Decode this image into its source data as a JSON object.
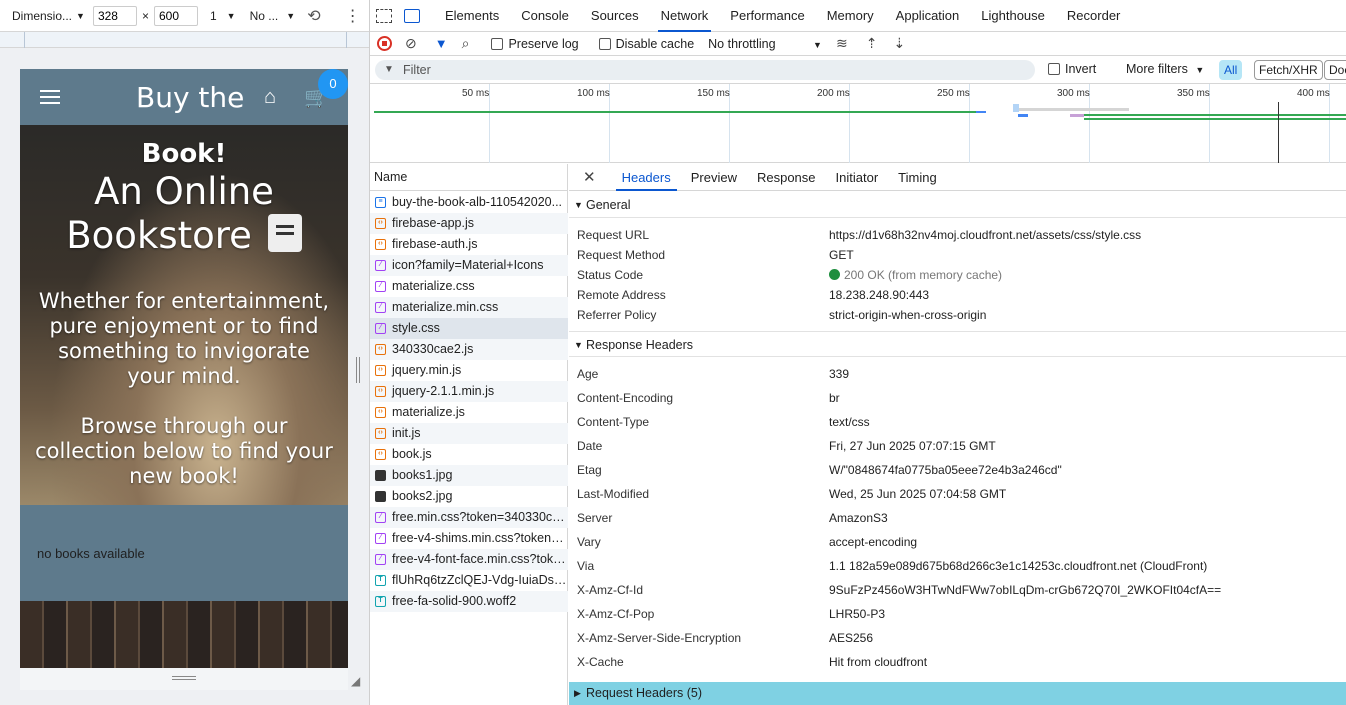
{
  "device_toolbar": {
    "dimensions_label": "Dimensio...",
    "width_value": "328",
    "times": "×",
    "height_value": "600",
    "dpr_value": "1",
    "throttle_value": "No ..."
  },
  "phone": {
    "header_title": "Buy the",
    "cart_count": "0",
    "hero_line1": "Book!",
    "hero_line2": "An Online",
    "hero_line3": "Bookstore",
    "hero_para1": [
      "Whether for entertainment,",
      "pure enjoyment or to find",
      "something to invigorate",
      "your mind."
    ],
    "hero_para2": [
      "Browse through our",
      "collection below to find your",
      "new book!"
    ],
    "empty_text": "no books available"
  },
  "devtools_tabs": [
    "Elements",
    "Console",
    "Sources",
    "Network",
    "Performance",
    "Memory",
    "Application",
    "Lighthouse",
    "Recorder"
  ],
  "active_tab": "Network",
  "network_toolbar": {
    "preserve_log": "Preserve log",
    "disable_cache": "Disable cache",
    "throttling": "No throttling"
  },
  "filter_row": {
    "placeholder": "Filter",
    "invert": "Invert",
    "more_filters": "More filters",
    "all_chip": "All",
    "fetch_chip": "Fetch/XHR",
    "doc_chip": "Doc"
  },
  "timeline_labels": [
    "50 ms",
    "100 ms",
    "150 ms",
    "200 ms",
    "250 ms",
    "300 ms",
    "350 ms",
    "400 ms"
  ],
  "name_header": "Name",
  "requests": [
    {
      "name": "buy-the-book-alb-110542020...",
      "type": "doc"
    },
    {
      "name": "firebase-app.js",
      "type": "js"
    },
    {
      "name": "firebase-auth.js",
      "type": "js"
    },
    {
      "name": "icon?family=Material+Icons",
      "type": "css"
    },
    {
      "name": "materialize.css",
      "type": "css"
    },
    {
      "name": "materialize.min.css",
      "type": "css"
    },
    {
      "name": "style.css",
      "type": "css"
    },
    {
      "name": "340330cae2.js",
      "type": "js"
    },
    {
      "name": "jquery.min.js",
      "type": "js"
    },
    {
      "name": "jquery-2.1.1.min.js",
      "type": "js"
    },
    {
      "name": "materialize.js",
      "type": "js"
    },
    {
      "name": "init.js",
      "type": "js"
    },
    {
      "name": "book.js",
      "type": "js"
    },
    {
      "name": "books1.jpg",
      "type": "img"
    },
    {
      "name": "books2.jpg",
      "type": "img"
    },
    {
      "name": "free.min.css?token=340330cae2",
      "type": "css"
    },
    {
      "name": "free-v4-shims.min.css?token=...",
      "type": "css"
    },
    {
      "name": "free-v4-font-face.min.css?toke...",
      "type": "css"
    },
    {
      "name": "flUhRq6tzZclQEJ-Vdg-IuiaDsN...",
      "type": "font"
    },
    {
      "name": "free-fa-solid-900.woff2",
      "type": "font"
    }
  ],
  "detail_tabs": [
    "Headers",
    "Preview",
    "Response",
    "Initiator",
    "Timing"
  ],
  "general": {
    "title": "General",
    "rows": [
      {
        "k": "Request URL",
        "v": "https://d1v68h32nv4moj.cloudfront.net/assets/css/style.css"
      },
      {
        "k": "Request Method",
        "v": "GET"
      },
      {
        "k": "Status Code",
        "v": "200 OK (from memory cache)"
      },
      {
        "k": "Remote Address",
        "v": "18.238.248.90:443"
      },
      {
        "k": "Referrer Policy",
        "v": "strict-origin-when-cross-origin"
      }
    ]
  },
  "response_headers": {
    "title": "Response Headers",
    "rows": [
      {
        "k": "Age",
        "v": "339"
      },
      {
        "k": "Content-Encoding",
        "v": "br"
      },
      {
        "k": "Content-Type",
        "v": "text/css"
      },
      {
        "k": "Date",
        "v": "Fri, 27 Jun 2025 07:07:15 GMT"
      },
      {
        "k": "Etag",
        "v": "W/\"0848674fa0775ba05eee72e4b3a246cd\""
      },
      {
        "k": "Last-Modified",
        "v": "Wed, 25 Jun 2025 07:04:58 GMT"
      },
      {
        "k": "Server",
        "v": "AmazonS3"
      },
      {
        "k": "Vary",
        "v": "accept-encoding"
      },
      {
        "k": "Via",
        "v": "1.1 182a59e089d675b68d266c3e1c14253c.cloudfront.net (CloudFront)"
      },
      {
        "k": "X-Amz-Cf-Id",
        "v": "9SuFzPz456oW3HTwNdFWw7obILqDm-crGb672Q70I_2WKOFIt04cfA=="
      },
      {
        "k": "X-Amz-Cf-Pop",
        "v": "LHR50-P3"
      },
      {
        "k": "X-Amz-Server-Side-Encryption",
        "v": "AES256"
      },
      {
        "k": "X-Cache",
        "v": "Hit from cloudfront"
      }
    ]
  },
  "request_headers_title": "Request Headers (5)",
  "colors": {
    "accent": "#0b57d0",
    "status_ok": "#1e8e3e",
    "phone_bg": "#5e7a8c",
    "badge": "#2196f3",
    "req_section": "#7fd1e3"
  }
}
